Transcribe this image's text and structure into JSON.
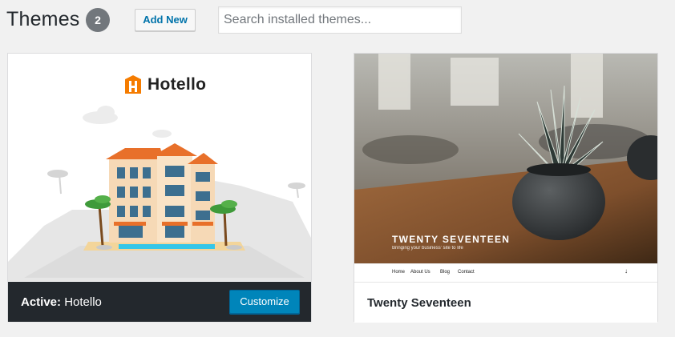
{
  "header": {
    "title": "Themes",
    "count": "2",
    "add_new_label": "Add New",
    "search_placeholder": "Search installed themes..."
  },
  "themes": [
    {
      "name": "Hotello",
      "logo_text": "Hotello",
      "active_prefix": "Active:",
      "active": true,
      "customize_label": "Customize"
    },
    {
      "name": "Twenty Seventeen",
      "active": false,
      "screenshot_title": "TWENTY SEVENTEEN",
      "screenshot_subtitle": "Bringing your business' site to life",
      "nav_items": [
        "Home",
        "About Us",
        "Blog",
        "Contact"
      ]
    }
  ],
  "colors": {
    "accent": "#0085ba",
    "active_bar": "#23282d",
    "page_bg": "#f1f1f1"
  }
}
